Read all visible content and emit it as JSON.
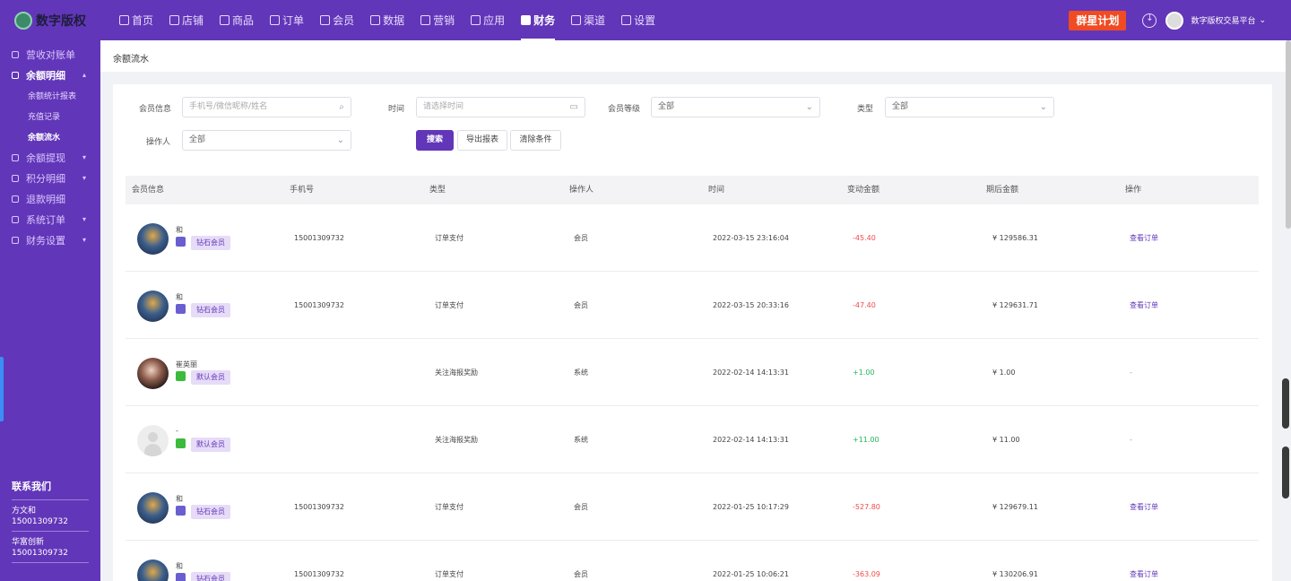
{
  "brand": {
    "name": "数字版权"
  },
  "nav": [
    {
      "label": "首页",
      "icon": "home-icon"
    },
    {
      "label": "店铺",
      "icon": "shop-icon"
    },
    {
      "label": "商品",
      "icon": "goods-icon"
    },
    {
      "label": "订单",
      "icon": "order-icon"
    },
    {
      "label": "会员",
      "icon": "user-icon"
    },
    {
      "label": "数据",
      "icon": "chart-icon"
    },
    {
      "label": "营销",
      "icon": "tag-icon"
    },
    {
      "label": "应用",
      "icon": "app-icon"
    },
    {
      "label": "财务",
      "icon": "finance-icon",
      "active": true
    },
    {
      "label": "渠道",
      "icon": "channel-icon"
    },
    {
      "label": "设置",
      "icon": "gear-icon"
    }
  ],
  "topbar": {
    "promo": "群星计划",
    "platform": "数字版权交易平台"
  },
  "sidebar": {
    "items": [
      {
        "label": "营收对账单"
      },
      {
        "label": "余额明细",
        "open": true,
        "subs": [
          "余额统计报表",
          "充值记录",
          "余额流水"
        ]
      },
      {
        "label": "余额提现"
      },
      {
        "label": "积分明细"
      },
      {
        "label": "退款明细"
      },
      {
        "label": "系统订单"
      },
      {
        "label": "财务设置"
      }
    ],
    "active_sub": "余额流水",
    "contact_title": "联系我们",
    "contacts": [
      {
        "name": "方文和",
        "phone": "15001309732"
      },
      {
        "name": "华富创新",
        "phone": "15001309732"
      }
    ]
  },
  "page": {
    "title": "余额流水"
  },
  "filters": {
    "member_label": "会员信息",
    "member_placeholder": "手机号/微信昵称/姓名",
    "time_label": "时间",
    "time_placeholder": "请选择时间",
    "level_label": "会员等级",
    "level_value": "全部",
    "type_label": "类型",
    "type_value": "全部",
    "operator_label": "操作人",
    "operator_value": "全部",
    "search_btn": "搜索",
    "export_btn": "导出报表",
    "clear_btn": "清除条件"
  },
  "table": {
    "columns": [
      "会员信息",
      "手机号",
      "类型",
      "操作人",
      "时间",
      "变动金额",
      "期后金额",
      "操作"
    ],
    "rows": [
      {
        "name": "和",
        "avatar": "photo",
        "source": "mini",
        "level": "钻石会员",
        "phone": "15001309732",
        "type": "订单支付",
        "operator": "会员",
        "time": "2022-03-15 23:16:04",
        "amount": "-45.40",
        "sign": "neg",
        "balance": "¥ 129586.31",
        "action": "查看订单"
      },
      {
        "name": "和",
        "avatar": "photo",
        "source": "mini",
        "level": "钻石会员",
        "phone": "15001309732",
        "type": "订单支付",
        "operator": "会员",
        "time": "2022-03-15 20:33:16",
        "amount": "-47.40",
        "sign": "neg",
        "balance": "¥ 129631.71",
        "action": "查看订单"
      },
      {
        "name": "崔英丽",
        "avatar": "girl",
        "source": "wx",
        "level": "默认会员",
        "phone": "",
        "type": "关注海报奖励",
        "operator": "系统",
        "time": "2022-02-14 14:13:31",
        "amount": "+1.00",
        "sign": "pos",
        "balance": "¥ 1.00",
        "action": "-"
      },
      {
        "name": "-",
        "avatar": "empty",
        "source": "wx",
        "level": "默认会员",
        "phone": "",
        "type": "关注海报奖励",
        "operator": "系统",
        "time": "2022-02-14 14:13:31",
        "amount": "+11.00",
        "sign": "pos",
        "balance": "¥ 11.00",
        "action": "-"
      },
      {
        "name": "和",
        "avatar": "photo",
        "source": "mini",
        "level": "钻石会员",
        "phone": "15001309732",
        "type": "订单支付",
        "operator": "会员",
        "time": "2022-01-25 10:17:29",
        "amount": "-527.80",
        "sign": "neg",
        "balance": "¥ 129679.11",
        "action": "查看订单"
      },
      {
        "name": "和",
        "avatar": "photo",
        "source": "mini",
        "level": "钻石会员",
        "phone": "15001309732",
        "type": "订单支付",
        "operator": "会员",
        "time": "2022-01-25 10:06:21",
        "amount": "-363.09",
        "sign": "neg",
        "balance": "¥ 130206.91",
        "action": "查看订单"
      }
    ]
  },
  "colors": {
    "brand": "#6236b8",
    "promo": "#f04b22",
    "negative": "#f04b4b",
    "positive": "#26b55a"
  }
}
